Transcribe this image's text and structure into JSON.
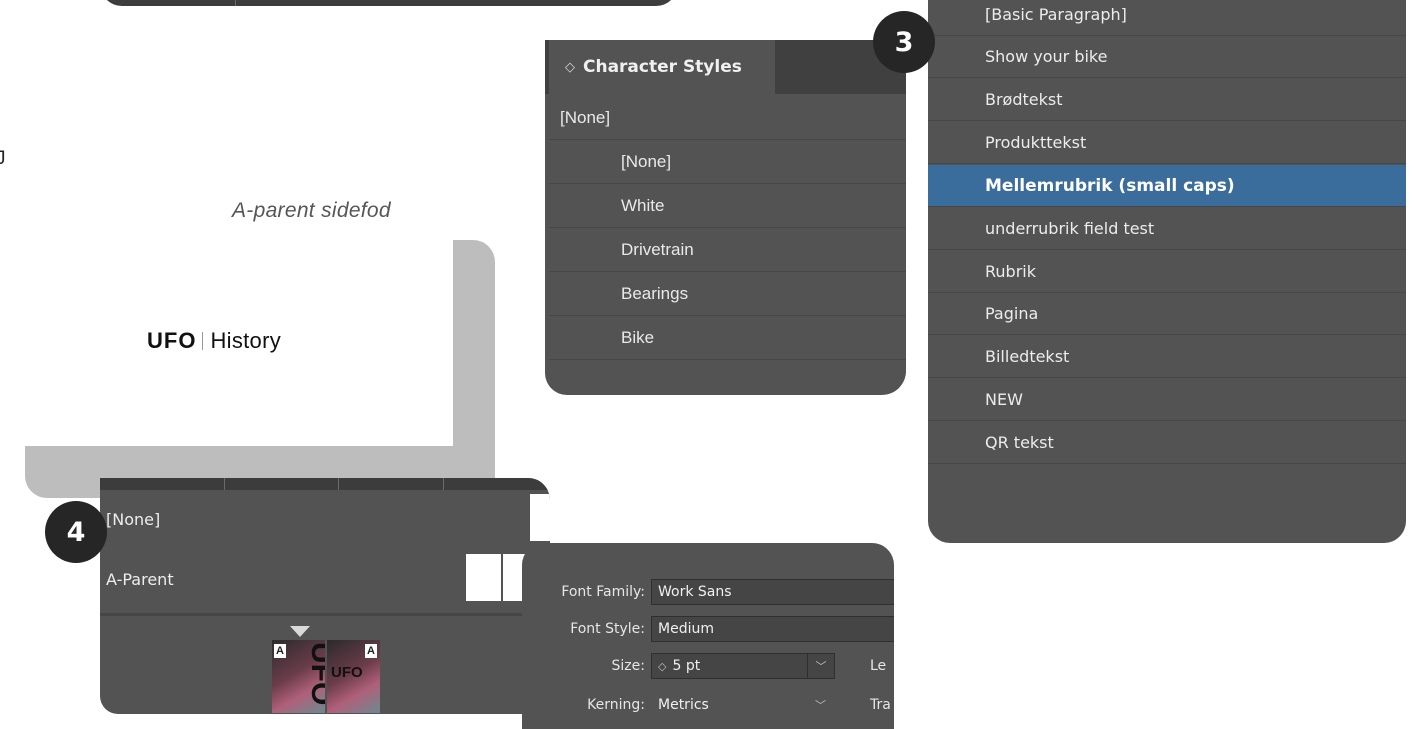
{
  "edge_glyph": "J",
  "page_preview": {
    "caption": "A-parent sidefod",
    "logo": "UFO",
    "title": "History"
  },
  "character_styles": {
    "tab_arrows": "◇",
    "tab_label": "Character Styles",
    "group": "[None]",
    "items": [
      "[None]",
      "White",
      "Drivetrain",
      "Bearings",
      "Bike"
    ]
  },
  "paragraph_styles": {
    "items": [
      "[Basic Paragraph]",
      "Show your bike",
      "Brødtekst",
      "Produkttekst",
      "Mellemrubrik (small caps)",
      "underrubrik field test",
      "Rubrik",
      "Pagina",
      "Billedtekst",
      "NEW",
      "QR tekst"
    ],
    "selected_index": 4,
    "selected_color": "#3b6d9c"
  },
  "badges": {
    "three": "3",
    "four": "4"
  },
  "pages_panel": {
    "parents": [
      "[None]",
      "A-Parent"
    ],
    "spread": {
      "left_letter": "A",
      "right_letter": "A",
      "logo": "UFO"
    }
  },
  "character_format": {
    "font_family_label": "Font Family:",
    "font_family_value": "Work Sans",
    "font_style_label": "Font Style:",
    "font_style_value": "Medium",
    "size_label": "Size:",
    "size_value": "5 pt",
    "leading_label_partial": "Le",
    "kerning_label": "Kerning:",
    "kerning_value": "Metrics",
    "tracking_label_partial": "Tra"
  },
  "colors": {
    "panel": "#535353",
    "panel_dark": "#3d3d3d",
    "badge": "#262626",
    "selection": "#3b6d9c"
  }
}
